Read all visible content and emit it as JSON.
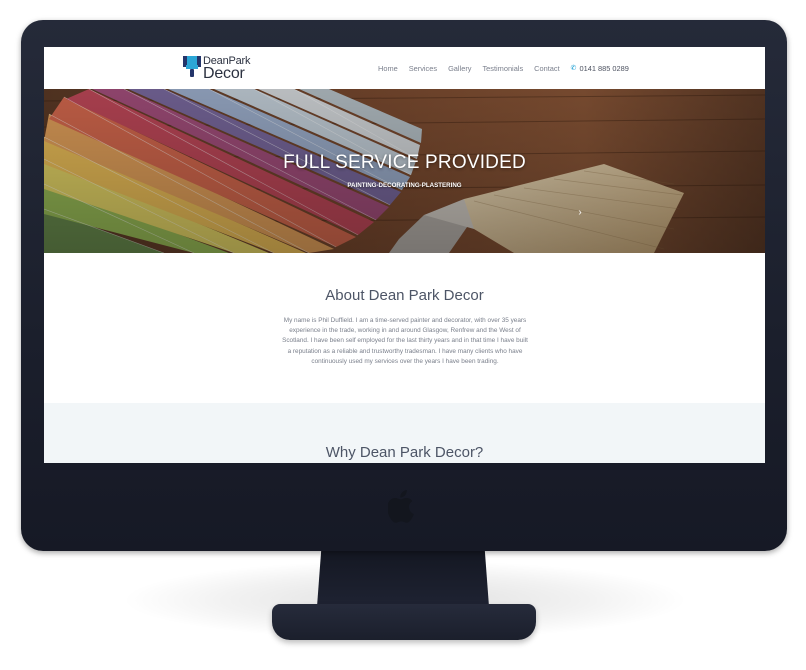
{
  "site": {
    "logo_line1": "DeanPark",
    "logo_line2": "Decor"
  },
  "nav": {
    "items": [
      {
        "label": "Home"
      },
      {
        "label": "Services"
      },
      {
        "label": "Gallery"
      },
      {
        "label": "Testimonials"
      },
      {
        "label": "Contact"
      }
    ],
    "phone": "0141 885 0289"
  },
  "hero": {
    "title": "FULL SERVICE PROVIDED",
    "subtitle": "PAINTING-DECORATING-PLASTERING",
    "next_arrow": "›"
  },
  "about": {
    "title": "About Dean Park Decor",
    "body_lines": [
      "My name is Phil Duffield. I am a time-served painter and decorator, with over 35 years",
      "experience in the trade, working in and around Glasgow, Renfrew and the West of",
      "Scotland. I have been self employed for the last thirty years and in that time I have built",
      "a reputation as a reliable and trustworthy tradesman. I have many clients who have",
      "continuously used my services over the years I have been trading."
    ]
  },
  "why": {
    "title": "Why Dean Park Decor?"
  },
  "colors": {
    "accent": "#2ba6d6",
    "heading": "#4d5566",
    "monitor": "#1b1f2c"
  },
  "icons": {
    "phone": "phone-icon",
    "apple": "apple-logo-icon",
    "next": "chevron-right-icon"
  }
}
